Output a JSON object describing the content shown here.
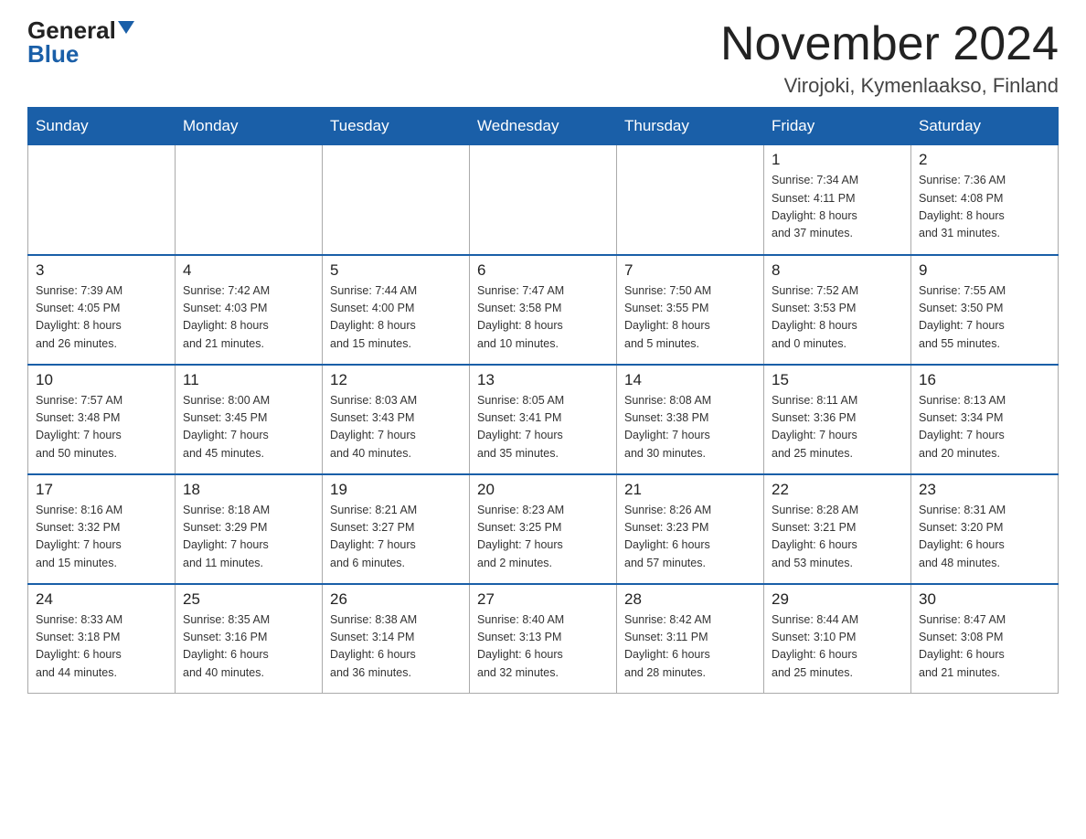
{
  "header": {
    "logo_general": "General",
    "logo_blue": "Blue",
    "month_title": "November 2024",
    "location": "Virojoki, Kymenlaakso, Finland"
  },
  "weekdays": [
    "Sunday",
    "Monday",
    "Tuesday",
    "Wednesday",
    "Thursday",
    "Friday",
    "Saturday"
  ],
  "weeks": [
    [
      {
        "day": "",
        "info": ""
      },
      {
        "day": "",
        "info": ""
      },
      {
        "day": "",
        "info": ""
      },
      {
        "day": "",
        "info": ""
      },
      {
        "day": "",
        "info": ""
      },
      {
        "day": "1",
        "info": "Sunrise: 7:34 AM\nSunset: 4:11 PM\nDaylight: 8 hours\nand 37 minutes."
      },
      {
        "day": "2",
        "info": "Sunrise: 7:36 AM\nSunset: 4:08 PM\nDaylight: 8 hours\nand 31 minutes."
      }
    ],
    [
      {
        "day": "3",
        "info": "Sunrise: 7:39 AM\nSunset: 4:05 PM\nDaylight: 8 hours\nand 26 minutes."
      },
      {
        "day": "4",
        "info": "Sunrise: 7:42 AM\nSunset: 4:03 PM\nDaylight: 8 hours\nand 21 minutes."
      },
      {
        "day": "5",
        "info": "Sunrise: 7:44 AM\nSunset: 4:00 PM\nDaylight: 8 hours\nand 15 minutes."
      },
      {
        "day": "6",
        "info": "Sunrise: 7:47 AM\nSunset: 3:58 PM\nDaylight: 8 hours\nand 10 minutes."
      },
      {
        "day": "7",
        "info": "Sunrise: 7:50 AM\nSunset: 3:55 PM\nDaylight: 8 hours\nand 5 minutes."
      },
      {
        "day": "8",
        "info": "Sunrise: 7:52 AM\nSunset: 3:53 PM\nDaylight: 8 hours\nand 0 minutes."
      },
      {
        "day": "9",
        "info": "Sunrise: 7:55 AM\nSunset: 3:50 PM\nDaylight: 7 hours\nand 55 minutes."
      }
    ],
    [
      {
        "day": "10",
        "info": "Sunrise: 7:57 AM\nSunset: 3:48 PM\nDaylight: 7 hours\nand 50 minutes."
      },
      {
        "day": "11",
        "info": "Sunrise: 8:00 AM\nSunset: 3:45 PM\nDaylight: 7 hours\nand 45 minutes."
      },
      {
        "day": "12",
        "info": "Sunrise: 8:03 AM\nSunset: 3:43 PM\nDaylight: 7 hours\nand 40 minutes."
      },
      {
        "day": "13",
        "info": "Sunrise: 8:05 AM\nSunset: 3:41 PM\nDaylight: 7 hours\nand 35 minutes."
      },
      {
        "day": "14",
        "info": "Sunrise: 8:08 AM\nSunset: 3:38 PM\nDaylight: 7 hours\nand 30 minutes."
      },
      {
        "day": "15",
        "info": "Sunrise: 8:11 AM\nSunset: 3:36 PM\nDaylight: 7 hours\nand 25 minutes."
      },
      {
        "day": "16",
        "info": "Sunrise: 8:13 AM\nSunset: 3:34 PM\nDaylight: 7 hours\nand 20 minutes."
      }
    ],
    [
      {
        "day": "17",
        "info": "Sunrise: 8:16 AM\nSunset: 3:32 PM\nDaylight: 7 hours\nand 15 minutes."
      },
      {
        "day": "18",
        "info": "Sunrise: 8:18 AM\nSunset: 3:29 PM\nDaylight: 7 hours\nand 11 minutes."
      },
      {
        "day": "19",
        "info": "Sunrise: 8:21 AM\nSunset: 3:27 PM\nDaylight: 7 hours\nand 6 minutes."
      },
      {
        "day": "20",
        "info": "Sunrise: 8:23 AM\nSunset: 3:25 PM\nDaylight: 7 hours\nand 2 minutes."
      },
      {
        "day": "21",
        "info": "Sunrise: 8:26 AM\nSunset: 3:23 PM\nDaylight: 6 hours\nand 57 minutes."
      },
      {
        "day": "22",
        "info": "Sunrise: 8:28 AM\nSunset: 3:21 PM\nDaylight: 6 hours\nand 53 minutes."
      },
      {
        "day": "23",
        "info": "Sunrise: 8:31 AM\nSunset: 3:20 PM\nDaylight: 6 hours\nand 48 minutes."
      }
    ],
    [
      {
        "day": "24",
        "info": "Sunrise: 8:33 AM\nSunset: 3:18 PM\nDaylight: 6 hours\nand 44 minutes."
      },
      {
        "day": "25",
        "info": "Sunrise: 8:35 AM\nSunset: 3:16 PM\nDaylight: 6 hours\nand 40 minutes."
      },
      {
        "day": "26",
        "info": "Sunrise: 8:38 AM\nSunset: 3:14 PM\nDaylight: 6 hours\nand 36 minutes."
      },
      {
        "day": "27",
        "info": "Sunrise: 8:40 AM\nSunset: 3:13 PM\nDaylight: 6 hours\nand 32 minutes."
      },
      {
        "day": "28",
        "info": "Sunrise: 8:42 AM\nSunset: 3:11 PM\nDaylight: 6 hours\nand 28 minutes."
      },
      {
        "day": "29",
        "info": "Sunrise: 8:44 AM\nSunset: 3:10 PM\nDaylight: 6 hours\nand 25 minutes."
      },
      {
        "day": "30",
        "info": "Sunrise: 8:47 AM\nSunset: 3:08 PM\nDaylight: 6 hours\nand 21 minutes."
      }
    ]
  ]
}
